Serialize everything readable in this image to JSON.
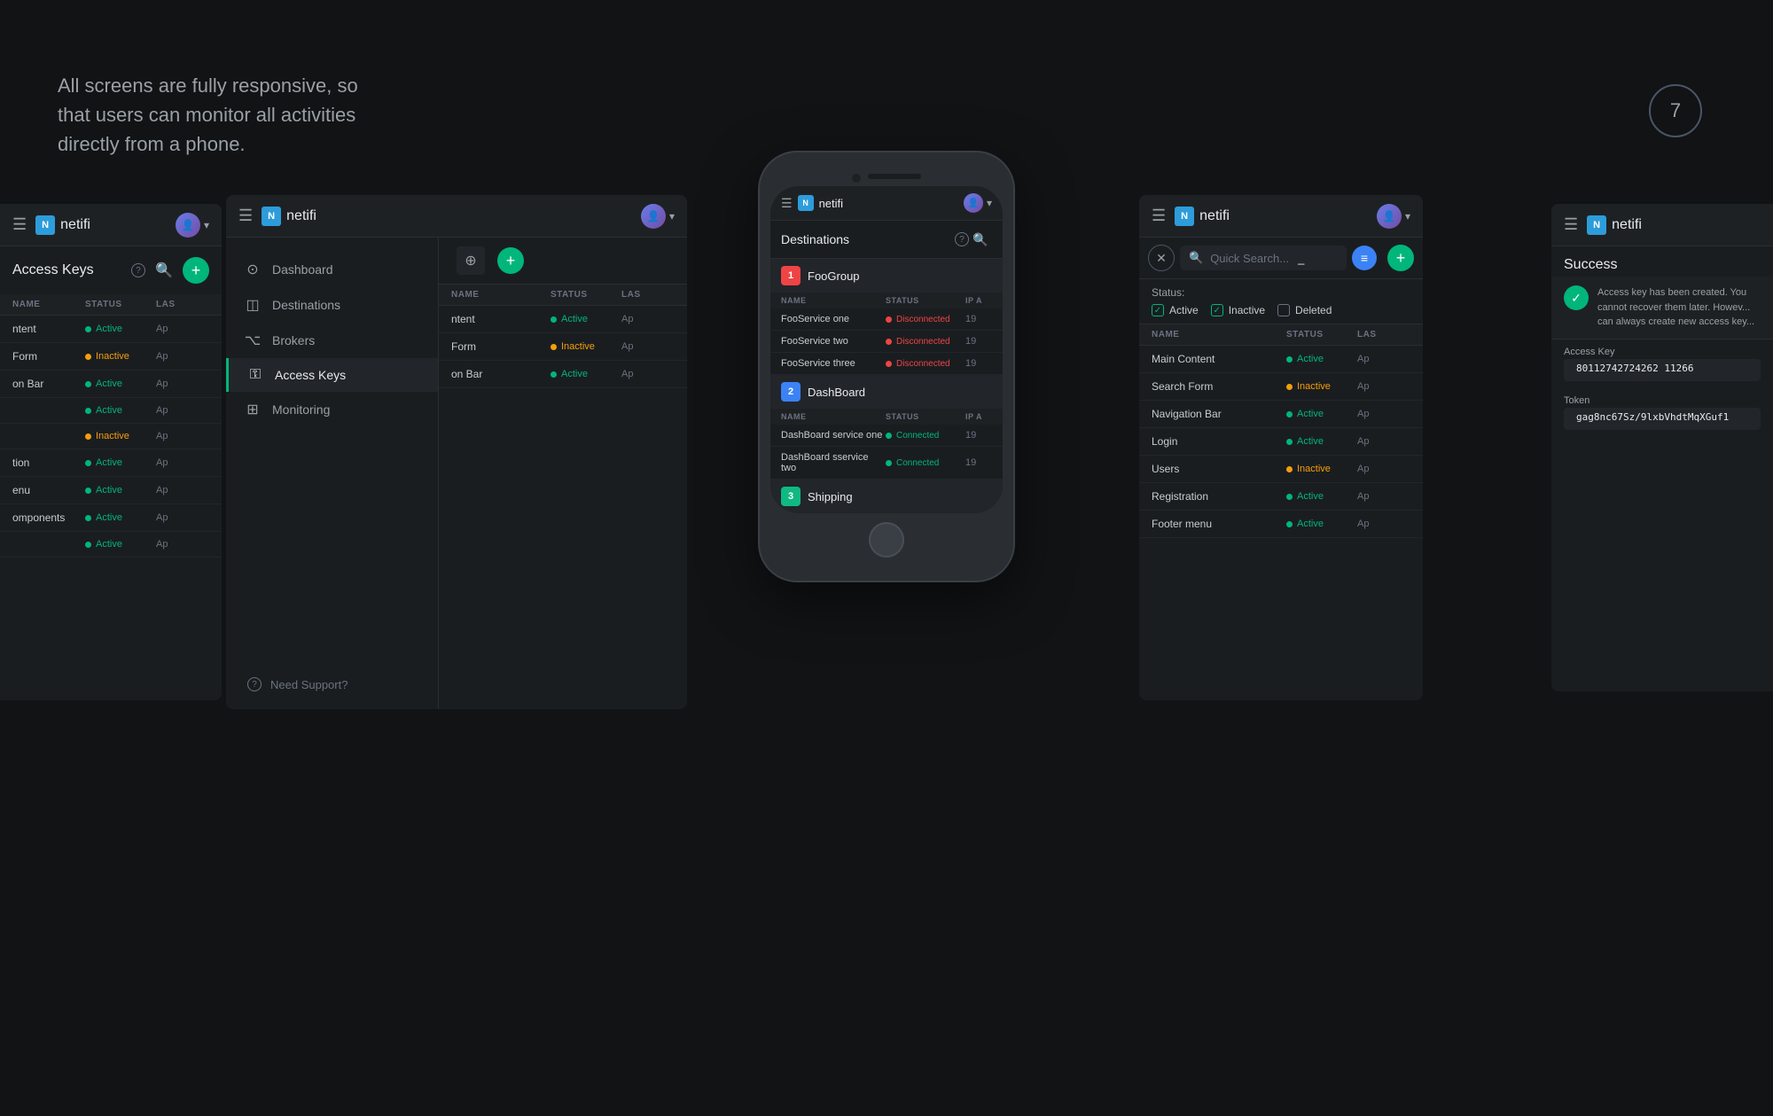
{
  "background": {
    "tagline": "All screens are fully responsive, so that users can monitor all activities directly from a phone.",
    "badge_number": "7"
  },
  "panel1": {
    "logo": "netifi",
    "title": "Access Keys",
    "columns": [
      "NAME",
      "STATUS",
      "LAS"
    ],
    "rows": [
      {
        "name": "Content",
        "status": "Active",
        "status_type": "active",
        "last": "Ap"
      },
      {
        "name": "Form",
        "status": "Inactive",
        "status_type": "inactive",
        "last": "Ap"
      },
      {
        "name": "on Bar",
        "status": "Active",
        "status_type": "active",
        "last": "Ap"
      },
      {
        "name": "",
        "status": "Active",
        "status_type": "active",
        "last": "Ap"
      },
      {
        "name": "",
        "status": "Inactive",
        "status_type": "inactive",
        "last": "Ap"
      },
      {
        "name": "tion",
        "status": "Active",
        "status_type": "active",
        "last": "Ap"
      },
      {
        "name": "enu",
        "status": "Active",
        "status_type": "active",
        "last": "Ap"
      },
      {
        "name": "omponents",
        "status": "Active",
        "status_type": "active",
        "last": "Ap"
      },
      {
        "name": "",
        "status": "Active",
        "status_type": "active",
        "last": "Ap"
      }
    ]
  },
  "panel2": {
    "logo": "netifi",
    "nav_items": [
      {
        "label": "Dashboard",
        "icon": "⊙",
        "active": false
      },
      {
        "label": "Destinations",
        "icon": "◫",
        "active": false
      },
      {
        "label": "Brokers",
        "icon": "⌥",
        "active": false
      },
      {
        "label": "Access Keys",
        "icon": "⚿",
        "active": true
      },
      {
        "label": "Monitoring",
        "icon": "⊞",
        "active": false
      }
    ],
    "footer": "Need Support?"
  },
  "panel3_phone": {
    "logo": "netifi",
    "title": "Destinations",
    "groups": [
      {
        "number": "1",
        "color": "red",
        "name": "FooGroup",
        "columns": [
          "NAME",
          "STATUS",
          "IP A"
        ],
        "rows": [
          {
            "name": "FooService one",
            "status": "Disconnected",
            "status_type": "disconnected",
            "ip": "19"
          },
          {
            "name": "FooService two",
            "status": "Disconnected",
            "status_type": "disconnected",
            "ip": "19"
          },
          {
            "name": "FooService three",
            "status": "Disconnected",
            "status_type": "disconnected",
            "ip": "19"
          }
        ]
      },
      {
        "number": "2",
        "color": "blue",
        "name": "DashBoard",
        "columns": [
          "NAME",
          "STATUS",
          "IP A"
        ],
        "rows": [
          {
            "name": "DashBoard service one",
            "status": "Connected",
            "status_type": "connected",
            "ip": "19"
          },
          {
            "name": "DashBoard sservice two",
            "status": "Connected",
            "status_type": "connected",
            "ip": "19"
          }
        ]
      },
      {
        "number": "3",
        "color": "teal",
        "name": "Shipping"
      }
    ]
  },
  "panel4": {
    "logo": "netifi",
    "search_placeholder": "Quick Search...",
    "search_label": "Quick Search _",
    "filters": {
      "label": "Status:",
      "options": [
        {
          "label": "Active",
          "checked": true
        },
        {
          "label": "Inactive",
          "checked": true
        },
        {
          "label": "Deleted",
          "checked": false
        }
      ]
    },
    "columns": [
      "NAME",
      "STATUS",
      "LAS"
    ],
    "rows": [
      {
        "name": "Main Content",
        "status": "Active",
        "status_type": "active",
        "last": "Ap"
      },
      {
        "name": "Search Form",
        "status": "Inactive",
        "status_type": "inactive",
        "last": "Ap"
      },
      {
        "name": "Navigation Bar",
        "status": "Active",
        "status_type": "active",
        "last": "Ap"
      },
      {
        "name": "Login",
        "status": "Active",
        "status_type": "active",
        "last": "Ap"
      },
      {
        "name": "Users",
        "status": "Inactive",
        "status_type": "inactive",
        "last": "Ap"
      },
      {
        "name": "Registration",
        "status": "Active",
        "status_type": "active",
        "last": "Ap"
      },
      {
        "name": "Footer menu",
        "status": "Active",
        "status_type": "active",
        "last": "Ap"
      }
    ]
  },
  "panel5": {
    "logo": "netifi",
    "title": "Success",
    "message": "Access key has been created. You cannot recover them later. Howev... can always create new access key...",
    "access_key_label": "Access Key",
    "access_key_value": "80112742724262 11266",
    "token_label": "Token",
    "token_value": "gag8nc67Sz/9lxbVhdtMqXGuf1"
  },
  "icons": {
    "menu": "☰",
    "search": "🔍",
    "plus": "+",
    "x": "✕",
    "chevron": "▾",
    "question": "?",
    "check": "✓",
    "filter": "≡",
    "dashboard": "⊙",
    "destinations": "◫",
    "brokers": "⌥",
    "access_keys": "⚿",
    "monitoring": "⊞",
    "support": "?"
  }
}
